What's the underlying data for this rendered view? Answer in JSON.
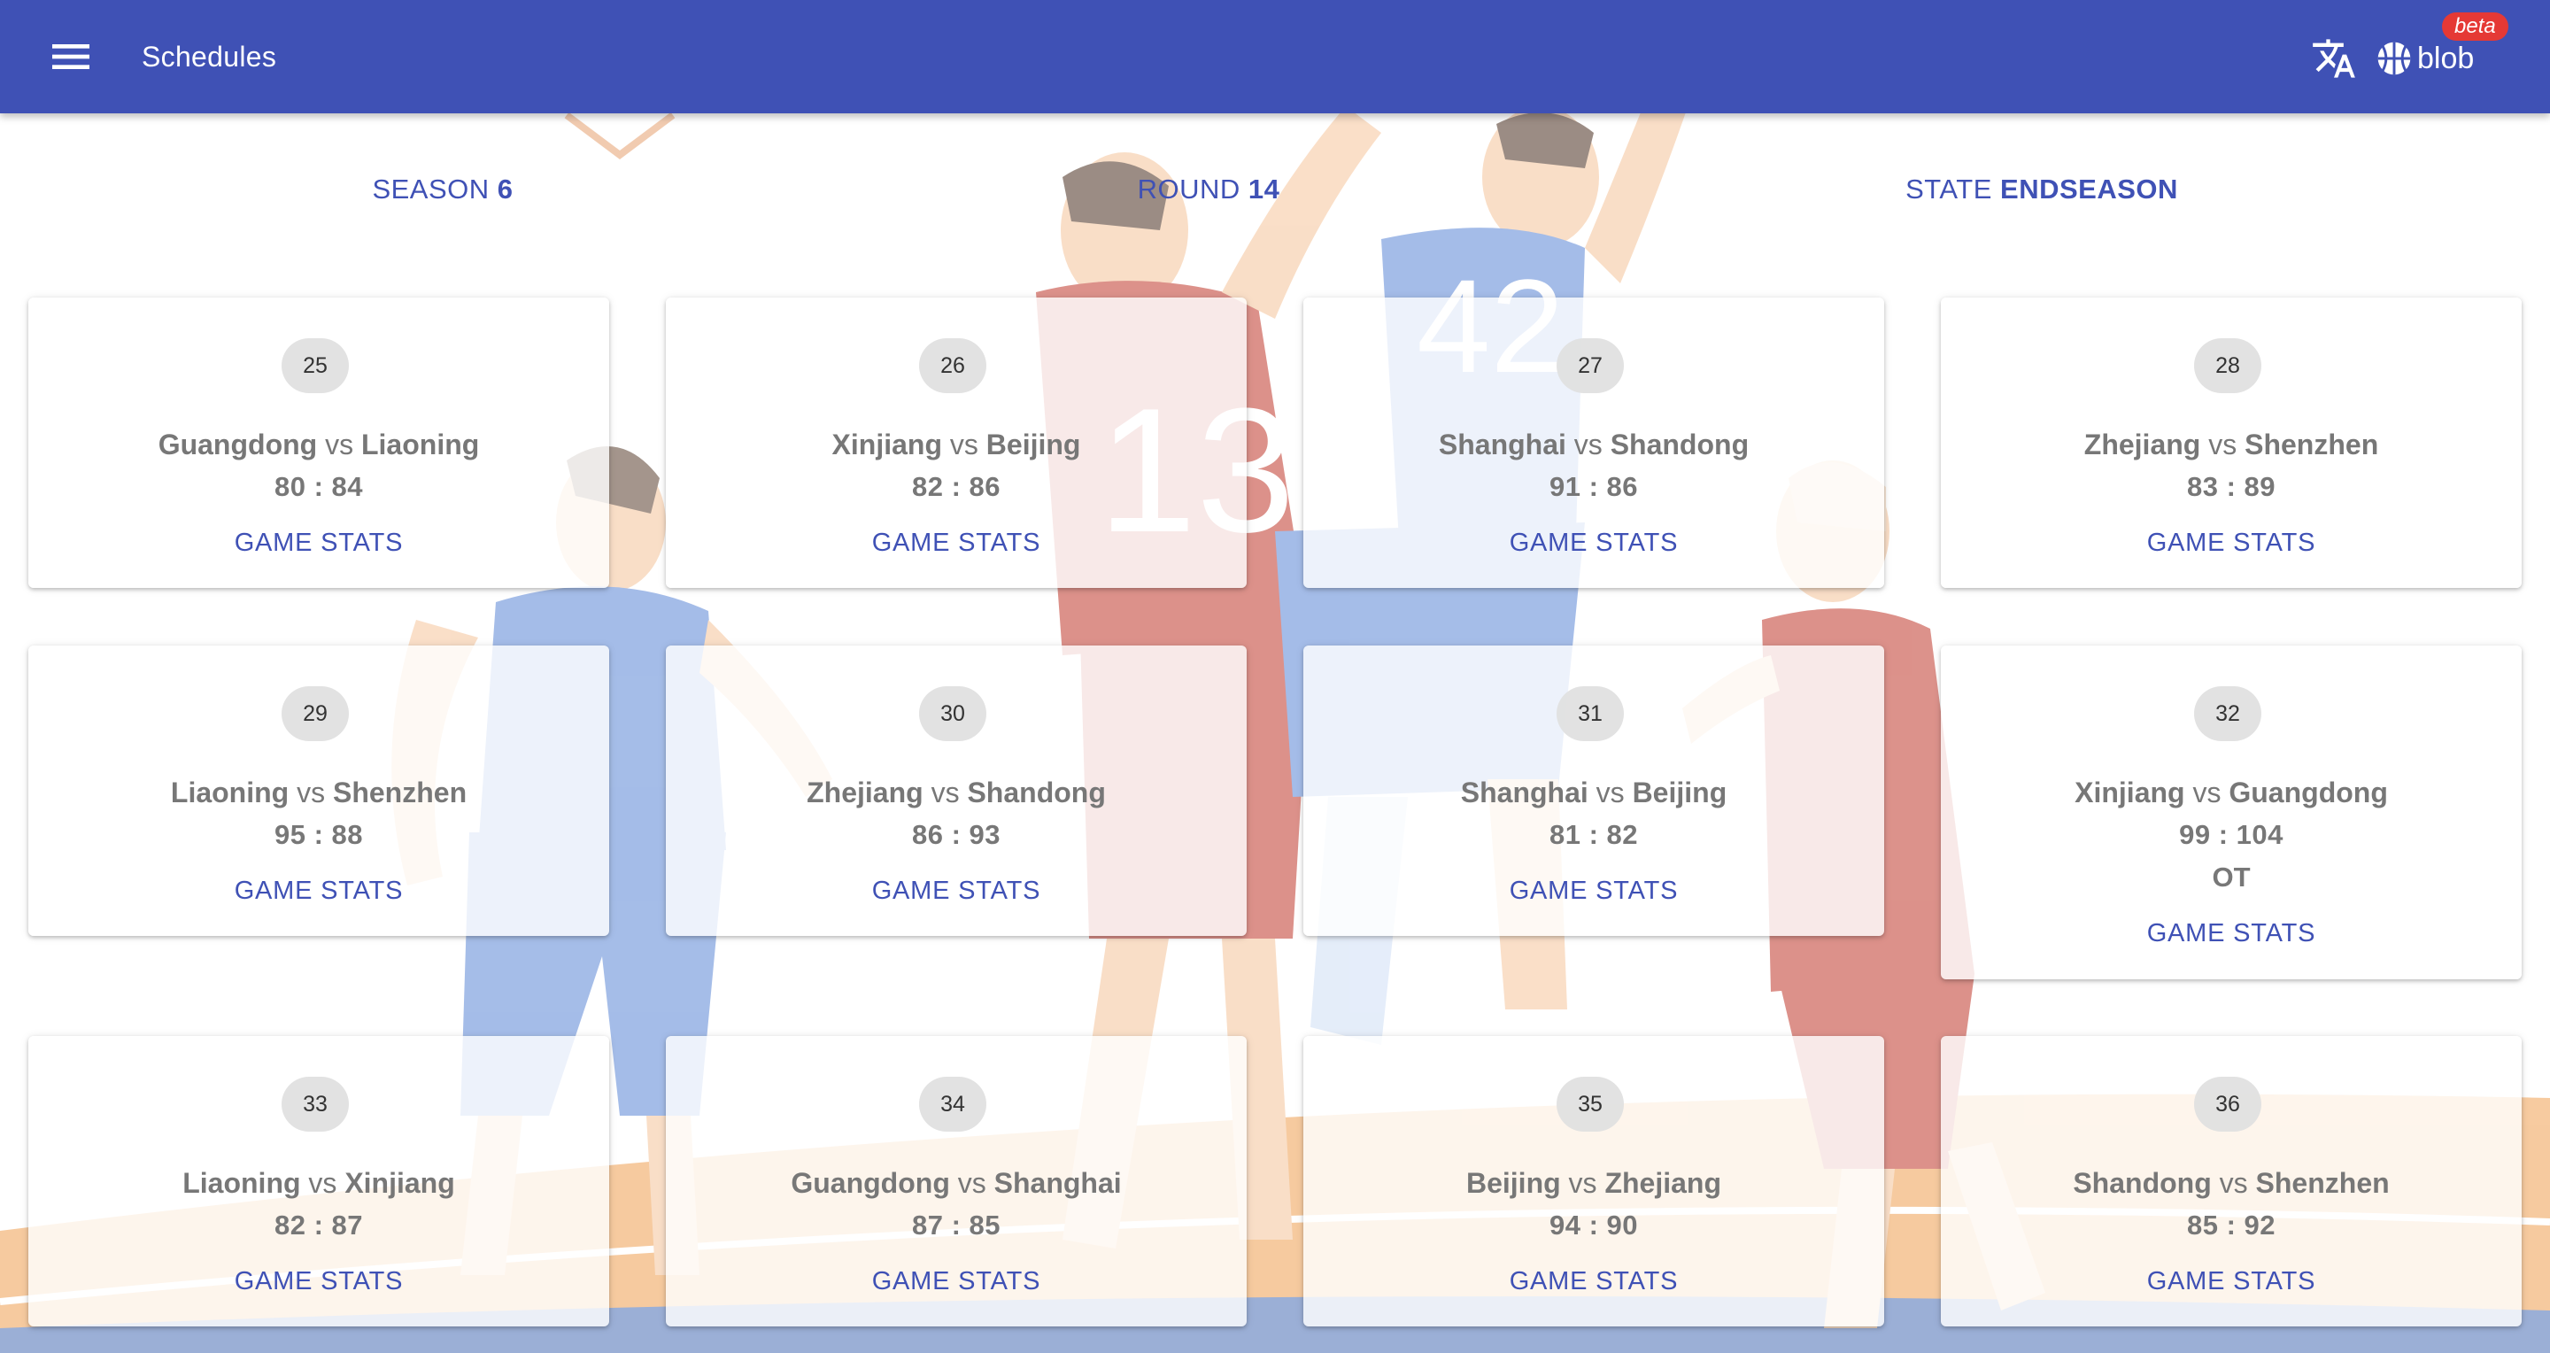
{
  "app": {
    "title": "Schedules",
    "user_name": "blob",
    "beta_label": "beta",
    "primary_color": "#3f51b5",
    "icons": {
      "menu": "menu-icon",
      "translate": "translate-icon",
      "user": "basketball-icon"
    }
  },
  "info": {
    "season_label": "SEASON",
    "season_value": "6",
    "round_label": "ROUND",
    "round_value": "14",
    "state_label": "STATE",
    "state_value": "ENDSEASON"
  },
  "games": [
    {
      "number": "25",
      "home": "Guangdong",
      "vs": "vs",
      "away": "Liaoning",
      "score": "80 : 84",
      "note": "",
      "stats_label": "GAME STATS"
    },
    {
      "number": "26",
      "home": "Xinjiang",
      "vs": "vs",
      "away": "Beijing",
      "score": "82 : 86",
      "note": "",
      "stats_label": "GAME STATS"
    },
    {
      "number": "27",
      "home": "Shanghai",
      "vs": "vs",
      "away": "Shandong",
      "score": "91 : 86",
      "note": "",
      "stats_label": "GAME STATS"
    },
    {
      "number": "28",
      "home": "Zhejiang",
      "vs": "vs",
      "away": "Shenzhen",
      "score": "83 : 89",
      "note": "",
      "stats_label": "GAME STATS"
    },
    {
      "number": "29",
      "home": "Liaoning",
      "vs": "vs",
      "away": "Shenzhen",
      "score": "95 : 88",
      "note": "",
      "stats_label": "GAME STATS"
    },
    {
      "number": "30",
      "home": "Zhejiang",
      "vs": "vs",
      "away": "Shandong",
      "score": "86 : 93",
      "note": "",
      "stats_label": "GAME STATS"
    },
    {
      "number": "31",
      "home": "Shanghai",
      "vs": "vs",
      "away": "Beijing",
      "score": "81 : 82",
      "note": "",
      "stats_label": "GAME STATS"
    },
    {
      "number": "32",
      "home": "Xinjiang",
      "vs": "vs",
      "away": "Guangdong",
      "score": "99 : 104",
      "note": "OT",
      "stats_label": "GAME STATS"
    },
    {
      "number": "33",
      "home": "Liaoning",
      "vs": "vs",
      "away": "Xinjiang",
      "score": "82 : 87",
      "note": "",
      "stats_label": "GAME STATS"
    },
    {
      "number": "34",
      "home": "Guangdong",
      "vs": "vs",
      "away": "Shanghai",
      "score": "87 : 85",
      "note": "",
      "stats_label": "GAME STATS"
    },
    {
      "number": "35",
      "home": "Beijing",
      "vs": "vs",
      "away": "Zhejiang",
      "score": "94 : 90",
      "note": "",
      "stats_label": "GAME STATS"
    },
    {
      "number": "36",
      "home": "Shandong",
      "vs": "vs",
      "away": "Shenzhen",
      "score": "85 : 92",
      "note": "",
      "stats_label": "GAME STATS"
    }
  ]
}
